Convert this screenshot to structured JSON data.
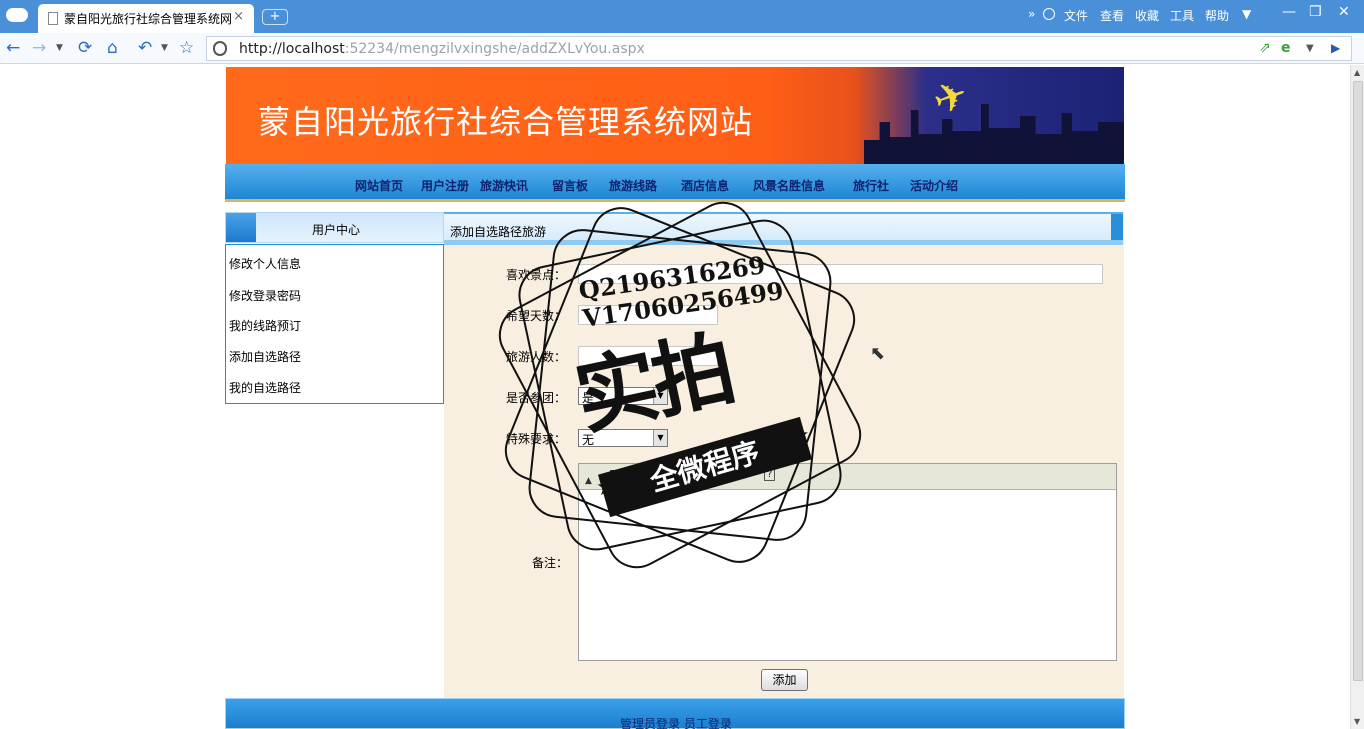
{
  "browser": {
    "tab_title": "蒙自阳光旅行社综合管理系统网",
    "tab_close": "×",
    "new_tab": "+",
    "menu": [
      "文件",
      "查看",
      "收藏",
      "工具",
      "帮助"
    ],
    "url_host": "http://localhost",
    "url_path": ":52234/mengzilvxingshe/addZXLvYou.aspx"
  },
  "banner": {
    "title": "蒙自阳光旅行社综合管理系统网站"
  },
  "nav": [
    "网站首页",
    "用户注册",
    "旅游快讯",
    "留言板",
    "旅游线路",
    "酒店信息",
    "风景名胜信息",
    "旅行社",
    "活动介绍"
  ],
  "sidebar": {
    "heading": "用户中心",
    "items": [
      "修改个人信息",
      "修改登录密码",
      "我的线路预订",
      "添加自选路径",
      "我的自选路径"
    ]
  },
  "form": {
    "heading": "添加自选路径旅游",
    "labels": {
      "scenery": "喜欢景点：",
      "days": "希望天数：",
      "people": "旅游人数：",
      "group": "是否参团：",
      "special": "特殊要求：",
      "notes": "备注："
    },
    "values": {
      "scenery": "",
      "days": "",
      "people": "",
      "group": "是",
      "special": "无"
    },
    "submit": "添加"
  },
  "footer": {
    "links": "管理员登录 员工登录"
  },
  "watermark": {
    "line1": "Q2196316269",
    "line2": "V17060256499",
    "big": "实拍",
    "ribbon": "全微程序"
  }
}
